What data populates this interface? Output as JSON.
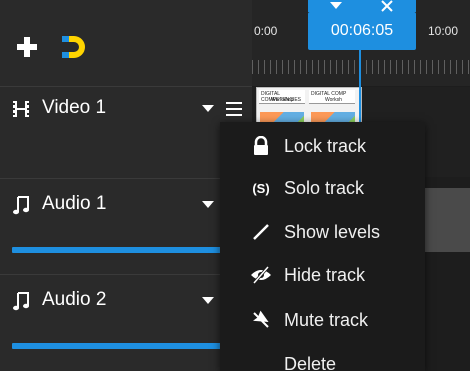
{
  "toolbar": {
    "add_icon": "plus-icon",
    "snap_icon": "magnet-icon",
    "accent_color": "#ffd400"
  },
  "tracks": [
    {
      "name": "Video 1",
      "icon": "film-icon",
      "level": null
    },
    {
      "name": "Audio 1",
      "icon": "music-note-icon",
      "level": 1.0
    },
    {
      "name": "Audio 2",
      "icon": "music-note-icon",
      "level": 1.0
    }
  ],
  "ruler": {
    "label_left": "0:00",
    "label_right": "10:00",
    "playhead_time": "00:06:05"
  },
  "context_menu": {
    "items": [
      {
        "label": "Lock track",
        "icon": "lock-icon"
      },
      {
        "label": "Solo track",
        "icon": "solo-icon",
        "icon_text": "(S)"
      },
      {
        "label": "Show levels",
        "icon": "pencil-line-icon"
      },
      {
        "label": "Hide track",
        "icon": "eye-slash-icon"
      },
      {
        "label": "Mute track",
        "icon": "mute-icon"
      },
      {
        "label": "Delete",
        "icon": "trash-icon"
      }
    ]
  },
  "clip": {
    "caption_left": "DIGITAL COMPETENCIES",
    "caption_left_sub": "Workshop",
    "caption_right": "DIGITAL COMP",
    "caption_right_sub": "Worksh"
  },
  "colors": {
    "accent_blue": "#1e8fe0",
    "panel_bg": "#2a2a2a",
    "menu_bg": "#1b1b1b"
  }
}
